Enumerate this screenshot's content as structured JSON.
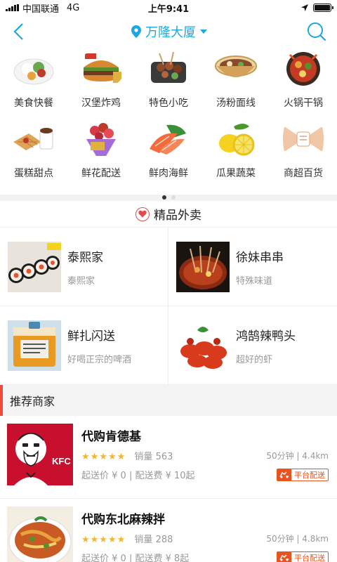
{
  "status_bar": {
    "carrier": "中国联通",
    "network": "4G",
    "time": "上午9:41"
  },
  "nav": {
    "location": "万隆大厦"
  },
  "categories": [
    {
      "label": "美食快餐",
      "icon": "rice-bowl-icon"
    },
    {
      "label": "汉堡炸鸡",
      "icon": "burger-icon"
    },
    {
      "label": "特色小吃",
      "icon": "skewer-pot-icon"
    },
    {
      "label": "汤粉面线",
      "icon": "noodle-bowl-icon"
    },
    {
      "label": "火锅干锅",
      "icon": "hotpot-icon"
    },
    {
      "label": "蛋糕甜点",
      "icon": "waffle-icon"
    },
    {
      "label": "鲜花配送",
      "icon": "flower-bouquet-icon"
    },
    {
      "label": "鲜肉海鲜",
      "icon": "salmon-icon"
    },
    {
      "label": "瓜果蔬菜",
      "icon": "lemon-icon"
    },
    {
      "label": "商超百货",
      "icon": "gift-bow-icon"
    }
  ],
  "carousel": {
    "pages": 2,
    "active": 1
  },
  "premium": {
    "title": "精品外卖",
    "items": [
      {
        "name": "泰熙家",
        "desc": "泰熙家"
      },
      {
        "name": "徐妹串串",
        "desc": "特殊味道"
      },
      {
        "name": "鲜扎闪送",
        "desc": "好喝正宗的啤酒"
      },
      {
        "name": "鸿鹄辣鸭头",
        "desc": "超好的虾"
      }
    ]
  },
  "recommended": {
    "title": "推荐商家",
    "shops": [
      {
        "name": "代购肯德基",
        "rating": 5,
        "sales_label": "销量",
        "sales": "563",
        "time_dist": "50分钟 | 4.4km",
        "fees": "起送价 ¥ 0 | 配送费 ¥ 10起",
        "tag": "平台配送",
        "logo_text": "KFC"
      },
      {
        "name": "代购东北麻辣拌",
        "rating": 5,
        "sales_label": "销量",
        "sales": "288",
        "time_dist": "50分钟 | 4.8km",
        "fees": "起送价 ¥ 0 | 配送费 ¥ 8起",
        "tag": "平台配送"
      }
    ]
  },
  "colors": {
    "accent": "#1ba8e0",
    "red": "#f04b3e",
    "star": "#f6b530",
    "tag": "#e8531e"
  }
}
